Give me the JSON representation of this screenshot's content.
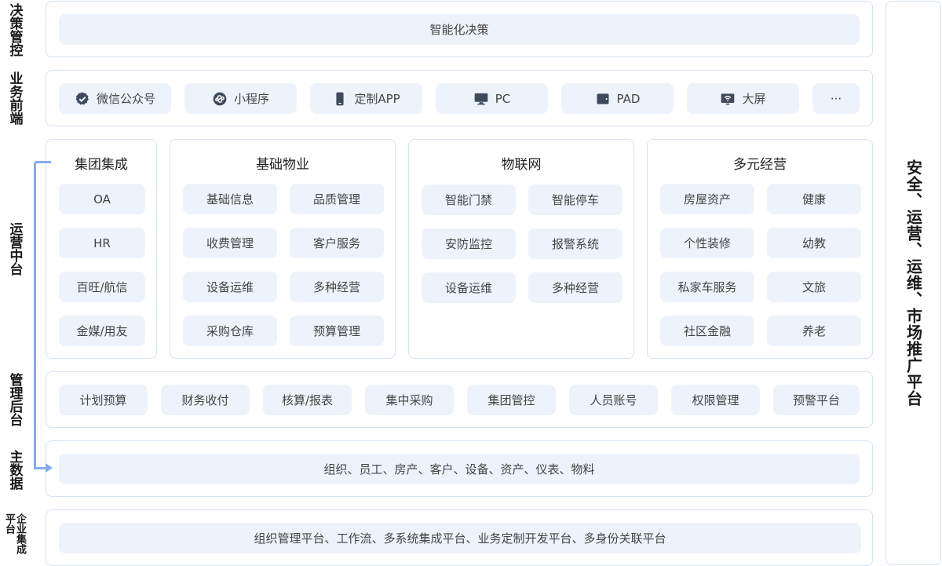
{
  "side_labels": {
    "decision": "决策管控",
    "business": "业务前端",
    "middle": "运营中台",
    "backend": "管理后台",
    "master": "主数据",
    "enterprise": "企业集成平台"
  },
  "decision": {
    "item": "智能化决策"
  },
  "frontend": {
    "items": [
      {
        "label": "微信公众号",
        "icon": "verified-badge-icon"
      },
      {
        "label": "小程序",
        "icon": "mini-program-icon"
      },
      {
        "label": "定制APP",
        "icon": "phone-icon"
      },
      {
        "label": "PC",
        "icon": "monitor-icon"
      },
      {
        "label": "PAD",
        "icon": "tablet-icon"
      },
      {
        "label": "大屏",
        "icon": "screen-icon"
      },
      {
        "label": "···",
        "icon": ""
      }
    ]
  },
  "middle": {
    "group": {
      "title": "集团集成",
      "items": [
        "OA",
        "HR",
        "百旺/航信",
        "金媒/用友"
      ]
    },
    "property": {
      "title": "基础物业",
      "items": [
        "基础信息",
        "品质管理",
        "收费管理",
        "客户服务",
        "设备运维",
        "多种经营",
        "采购仓库",
        "预算管理"
      ]
    },
    "iot": {
      "title": "物联网",
      "items": [
        "智能门禁",
        "智能停车",
        "安防监控",
        "报警系统",
        "设备运维",
        "多种经营"
      ]
    },
    "diverse": {
      "title": "多元经营",
      "items": [
        "房屋资产",
        "健康",
        "个性装修",
        "幼教",
        "私家车服务",
        "文旅",
        "社区金融",
        "养老"
      ]
    }
  },
  "backend": {
    "items": [
      "计划预算",
      "财务收付",
      "核算/报表",
      "集中采购",
      "集团管控",
      "人员账号",
      "权限管理",
      "预警平台"
    ]
  },
  "master": {
    "item": "组织、员工、房产、客户、设备、资产、仪表、物料"
  },
  "enterprise": {
    "item": "组织管理平台、工作流、多系统集成平台、业务定制开发平台、多身份关联平台"
  },
  "right": {
    "label": "安全、运营、运维、市场推广平台"
  },
  "colors": {
    "pill_bg": "#eef3fb",
    "border": "#d7e2f0",
    "accent": "#84abef",
    "icon": "#3f4a5c"
  }
}
